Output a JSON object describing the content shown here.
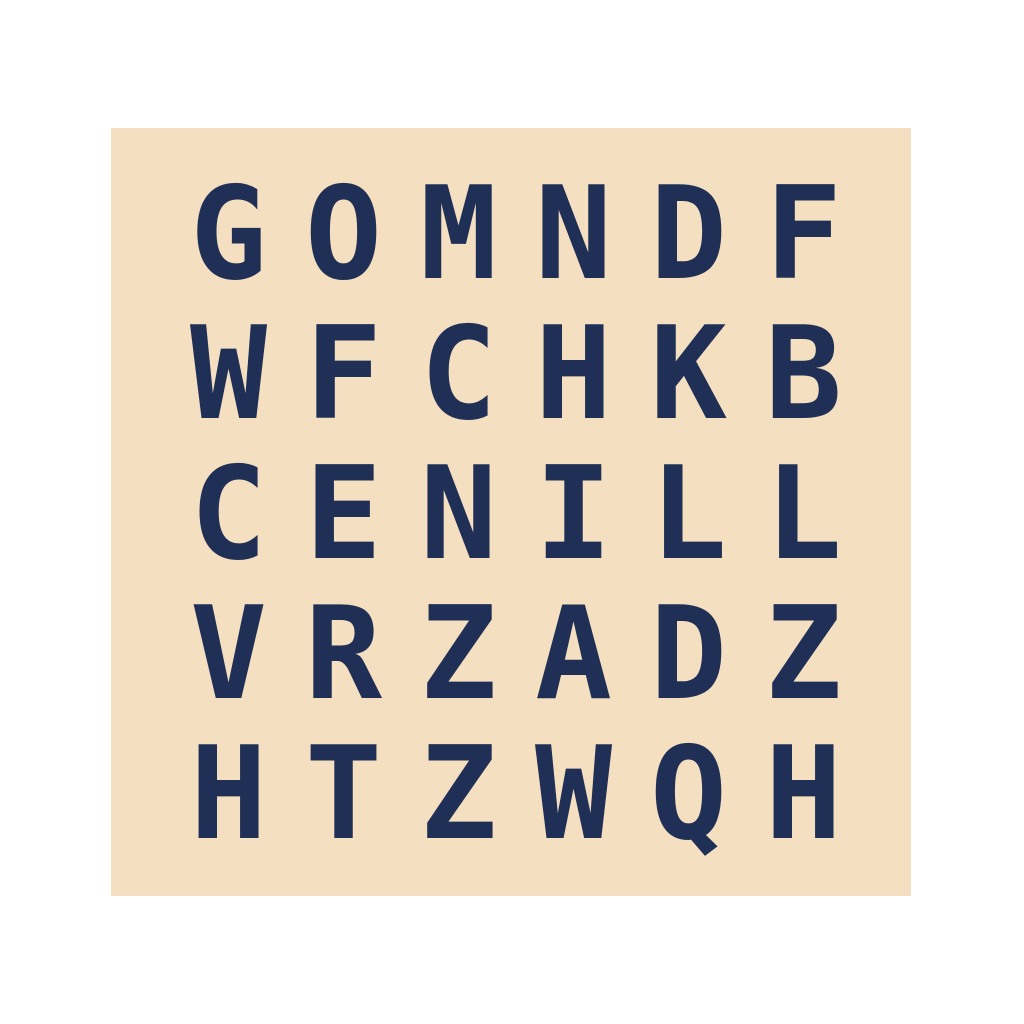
{
  "puzzle": {
    "rows": [
      [
        "G",
        "O",
        "M",
        "N",
        "D",
        "F"
      ],
      [
        "W",
        "F",
        "C",
        "H",
        "K",
        "B"
      ],
      [
        "C",
        "E",
        "N",
        "I",
        "L",
        "L"
      ],
      [
        "V",
        "R",
        "Z",
        "A",
        "D",
        "Z"
      ],
      [
        "H",
        "T",
        "Z",
        "W",
        "Q",
        "H"
      ]
    ]
  },
  "colors": {
    "board": "#f5dfc1",
    "letter": "#1f2f55",
    "background": "#ffffff"
  }
}
